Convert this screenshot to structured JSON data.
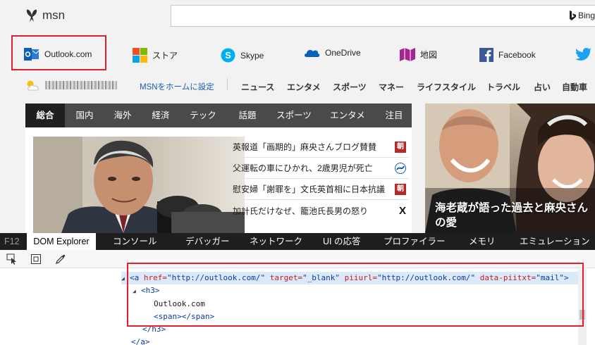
{
  "header": {
    "logo_text": "msn",
    "search_value": "",
    "bing_label": "Bing"
  },
  "quicklinks": [
    {
      "label": "Outlook.com",
      "icon": "outlook-icon"
    },
    {
      "label": "ストア",
      "icon": "store-icon"
    },
    {
      "label": "Skype",
      "icon": "skype-icon"
    },
    {
      "label": "OneDrive",
      "icon": "onedrive-icon"
    },
    {
      "label": "地図",
      "icon": "maps-icon"
    },
    {
      "label": "Facebook",
      "icon": "facebook-icon"
    },
    {
      "label": "",
      "icon": "twitter-icon"
    }
  ],
  "subnav": {
    "weather_icon": "partly-sunny-icon",
    "set_home": "MSNをホームに設定",
    "items": [
      "ニュース",
      "エンタメ",
      "スポーツ",
      "マネー",
      "ライフスタイル",
      "トラベル",
      "占い",
      "自動車"
    ]
  },
  "tabs": [
    "総合",
    "国内",
    "海外",
    "経済",
    "テック",
    "話題",
    "スポーツ",
    "エンタメ",
    "注目"
  ],
  "headlines": [
    {
      "title": "英報道「画期的」麻央さんブログ賛賛",
      "source_badge": "朝"
    },
    {
      "title": "父運転の車にひかれ、2歳男児が死亡",
      "source_badge": ""
    },
    {
      "title": "慰安婦「謝罪を」文氏英首相に日本抗議",
      "source_badge": "朝"
    },
    {
      "title": "加計氏だけなぜ、籠池氏長男の怒り",
      "source_badge": "X"
    }
  ],
  "featured_caption": "海老蔵が語った過去と麻央さんの愛",
  "devtools": {
    "f12_label": "F12",
    "tabs": [
      "DOM Explorer",
      "コンソール",
      "デバッガー",
      "ネットワーク",
      "UI の応答",
      "プロファイラー",
      "メモリ",
      "エミュレーション"
    ],
    "dom_lines": {
      "a_open": "<a",
      "href_attr": "href=",
      "href_val": "\"http://outlook.com/\"",
      "target_attr": "target=",
      "target_val": "\"_blank\"",
      "piiurl_attr": "piiurl=",
      "piiurl_val": "\"http://outlook.com/\"",
      "piitxt_attr": "data-piitxt=",
      "piitxt_val": "\"mail\"",
      "a_close_bracket": ">",
      "h3_open": "<h3>",
      "text_node": "Outlook.com",
      "span_node": "<span></span>",
      "h3_close": "</h3>",
      "a_close": "</a>"
    }
  },
  "colors": {
    "accent_red": "#e0202e",
    "link_blue": "#1b5fad",
    "devtools_tab_bar": "#1e1e1e",
    "selected_row": "#dbe9f9"
  }
}
